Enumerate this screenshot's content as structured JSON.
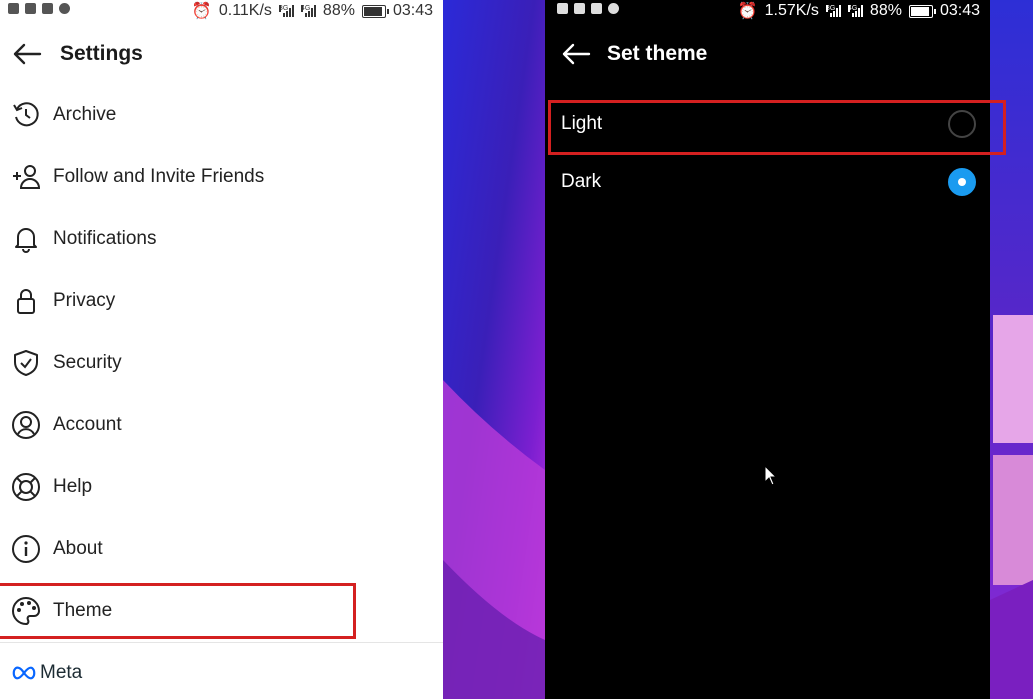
{
  "left_phone": {
    "status_bar": {
      "speed": "0.11K/s",
      "net1": "3G",
      "net2": "4G",
      "battery": "88%",
      "time": "03:43"
    },
    "header": {
      "title": "Settings",
      "back_icon": "arrow-left-icon"
    },
    "menu": [
      {
        "label": "Archive",
        "icon": "archive-clock-icon"
      },
      {
        "label": "Follow and Invite Friends",
        "icon": "add-person-icon"
      },
      {
        "label": "Notifications",
        "icon": "bell-icon"
      },
      {
        "label": "Privacy",
        "icon": "lock-icon"
      },
      {
        "label": "Security",
        "icon": "shield-check-icon"
      },
      {
        "label": "Account",
        "icon": "user-circle-icon"
      },
      {
        "label": "Help",
        "icon": "lifebuoy-icon"
      },
      {
        "label": "About",
        "icon": "info-icon"
      },
      {
        "label": "Theme",
        "icon": "palette-icon"
      }
    ],
    "footer": {
      "brand": "Meta"
    }
  },
  "right_phone": {
    "status_bar": {
      "speed": "1.57K/s",
      "net1": "3G",
      "net2": "4G",
      "battery": "88%",
      "time": "03:43"
    },
    "header": {
      "title": "Set theme",
      "back_icon": "arrow-left-icon"
    },
    "options": [
      {
        "label": "Light",
        "selected": false
      },
      {
        "label": "Dark",
        "selected": true
      }
    ]
  },
  "colors": {
    "highlight": "#d42020",
    "radio_selected": "#1a9bf0",
    "light_bg": "#ffffff",
    "dark_bg": "#000000"
  }
}
